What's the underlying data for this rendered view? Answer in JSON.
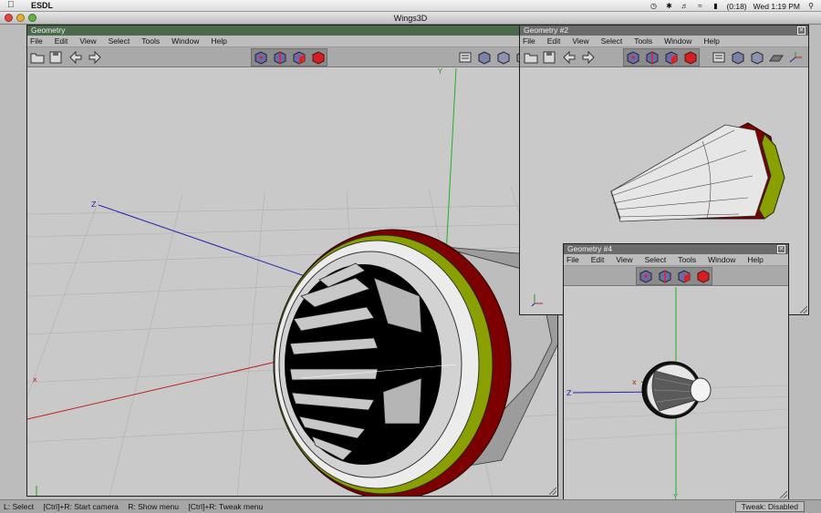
{
  "menubar": {
    "app_name": "ESDL",
    "battery": "(0:18)",
    "clock": "Wed 1:19 PM"
  },
  "window": {
    "title": "Wings3D"
  },
  "geom_menu": [
    "File",
    "Edit",
    "View",
    "Select",
    "Tools",
    "Window",
    "Help"
  ],
  "main": {
    "title": "Geometry",
    "axes": {
      "x": "x",
      "y": "Y",
      "z": "Z"
    }
  },
  "geom2": {
    "title": "Geometry #2"
  },
  "geom4": {
    "title": "Geometry #4",
    "axes": {
      "x": "x",
      "y": "Y",
      "z": "Z"
    }
  },
  "status": {
    "select": "L: Select",
    "camera": "[Ctrl]+R: Start camera",
    "show_menu": "R: Show menu",
    "tweak_menu": "[Ctrl]+R: Tweak menu",
    "tweak_state": "Tweak: Disabled"
  },
  "colors": {
    "title_active": "#4b6a4b",
    "ring_red": "#8b0a0a",
    "ring_green": "#8aa000",
    "mode_icon": "#6b6ba8"
  }
}
